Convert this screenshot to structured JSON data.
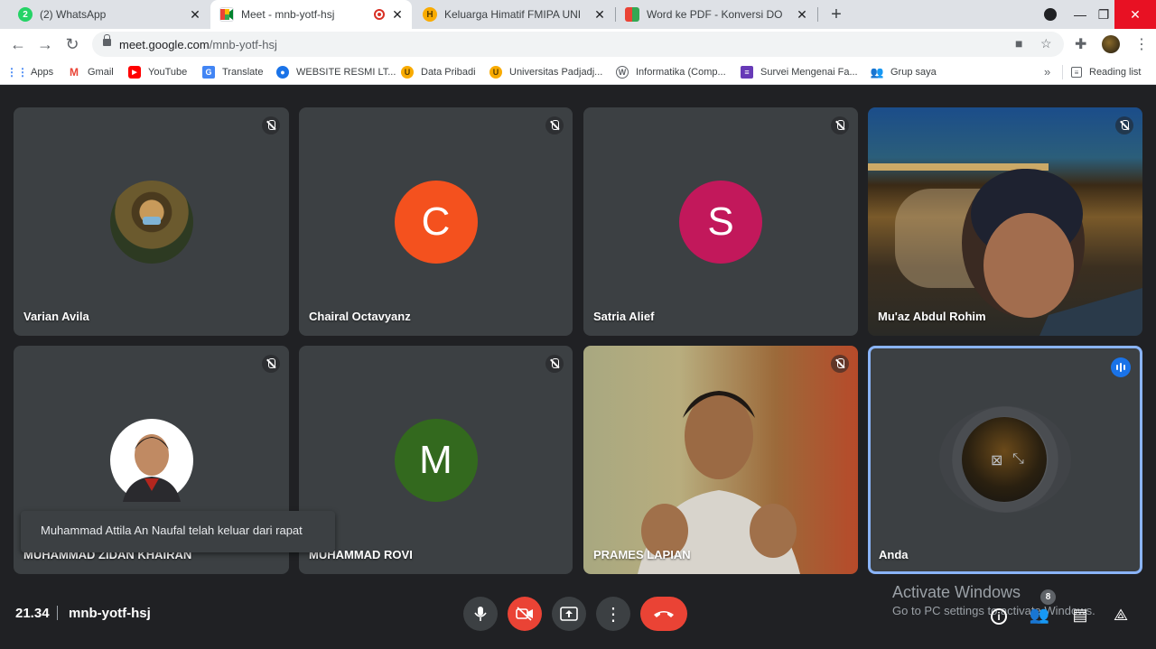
{
  "browser": {
    "tabs": [
      {
        "title": "(2) WhatsApp",
        "favicon": "whatsapp-icon",
        "color": "#25d366",
        "badge": "2"
      },
      {
        "title": "Meet - mnb-yotf-hsj",
        "favicon": "google-meet-icon",
        "color": "#00897b",
        "recording": true,
        "active": true
      },
      {
        "title": "Keluarga Himatif FMIPA UNPAD",
        "favicon": "himatif-icon",
        "color": "#f9ab00"
      },
      {
        "title": "Word ke PDF - Konversi DOC and",
        "favicon": "ilovepdf-icon",
        "color": "#e94235"
      }
    ],
    "url_host": "meet.google.com",
    "url_path": "/mnb-yotf-hsj",
    "bookmarks": [
      {
        "label": "Apps",
        "icon": "apps-grid-icon",
        "color": "#4285f4"
      },
      {
        "label": "Gmail",
        "icon": "gmail-icon",
        "color": "#ea4335"
      },
      {
        "label": "YouTube",
        "icon": "youtube-icon",
        "color": "#ff0000"
      },
      {
        "label": "Translate",
        "icon": "translate-icon",
        "color": "#4285f4"
      },
      {
        "label": "WEBSITE RESMI LT...",
        "icon": "globe-icon",
        "color": "#1a73e8"
      },
      {
        "label": "Data Pribadi",
        "icon": "unpad-icon",
        "color": "#f9ab00"
      },
      {
        "label": "Universitas Padjadj...",
        "icon": "unpad-icon",
        "color": "#f9ab00"
      },
      {
        "label": "Informatika (Comp...",
        "icon": "wikipedia-icon",
        "color": "#5f6368"
      },
      {
        "label": "Survei Mengenai Fa...",
        "icon": "forms-icon",
        "color": "#673ab7"
      },
      {
        "label": "Grup saya",
        "icon": "groups-icon",
        "color": "#4285f4"
      }
    ],
    "reading_list": "Reading list"
  },
  "meet": {
    "participants": [
      {
        "name": "Varian Avila",
        "type": "photo",
        "muted": true
      },
      {
        "name": "Chairal Octavyanz",
        "type": "initial",
        "initial": "C",
        "color": "#f4511e",
        "muted": true
      },
      {
        "name": "Satria Alief",
        "type": "initial",
        "initial": "S",
        "color": "#c2185b",
        "muted": true
      },
      {
        "name": "Mu'az Abdul Rohim",
        "type": "video",
        "muted": true
      },
      {
        "name": "MUHAMMAD ZIDAN KHAIRAN",
        "type": "photo",
        "muted": true
      },
      {
        "name": "MUHAMMAD ROVI",
        "type": "initial",
        "initial": "M",
        "color": "#33691e",
        "muted": true
      },
      {
        "name": "PRAMES LAPIAN",
        "type": "video",
        "muted": true
      },
      {
        "name": "Anda",
        "type": "self",
        "speaking": true
      }
    ],
    "toast": "Muhammad Attila An Naufal telah keluar dari rapat",
    "time": "21.34",
    "meeting_code": "mnb-yotf-hsj",
    "participant_count": "8",
    "self_tile_border": "#8ab4f8"
  },
  "os": {
    "activate_title": "Activate Windows",
    "activate_sub": "Go to PC settings to activate Windows."
  }
}
